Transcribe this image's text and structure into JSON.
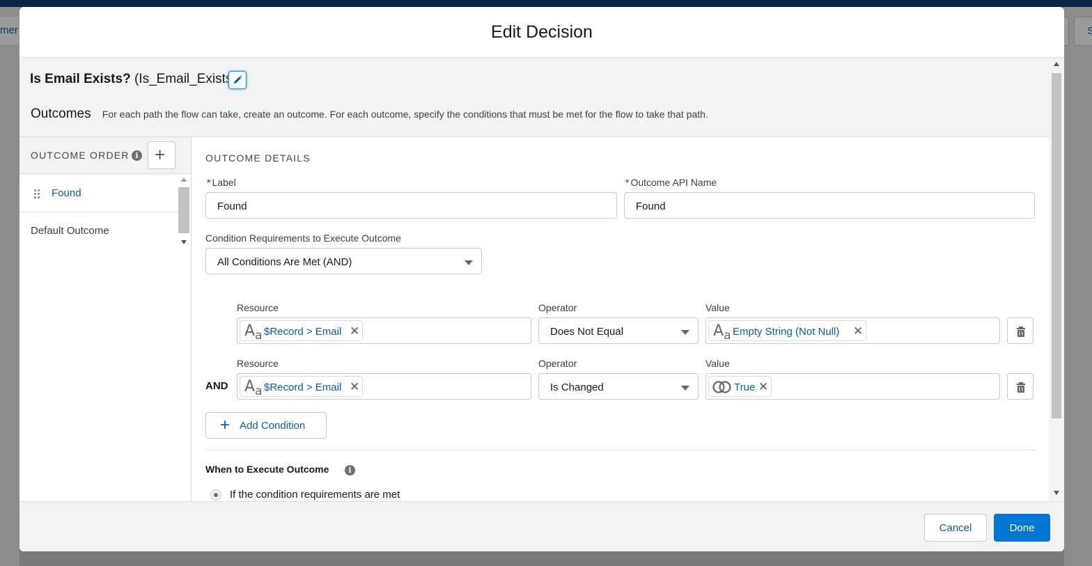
{
  "background": {
    "left_button_text": "mer",
    "right_button_text": "S"
  },
  "modal": {
    "title": "Edit Decision"
  },
  "decision": {
    "label": "Is Email Exists?",
    "api_name": "(Is_Email_Exists)"
  },
  "outcomes": {
    "heading": "Outcomes",
    "description": "For each path the flow can take, create an outcome. For each outcome, specify the conditions that must be met for the flow to take that path."
  },
  "outcome_order": {
    "header": "OUTCOME ORDER",
    "info_icon": "i",
    "add_icon": "+",
    "items": [
      {
        "label": "Found",
        "selected": true
      },
      {
        "label": "Default Outcome",
        "selected": false
      }
    ]
  },
  "details": {
    "section_title": "OUTCOME DETAILS",
    "required_marker": "*",
    "label_field": {
      "label": "Label",
      "value": "Found"
    },
    "api_field": {
      "label": "Outcome API Name",
      "value": "Found"
    },
    "requirements": {
      "label": "Condition Requirements to Execute Outcome",
      "value": "All Conditions Are Met (AND)"
    },
    "conditions": [
      {
        "resource_label": "Resource",
        "resource_value": "$Record > Email",
        "operator_label": "Operator",
        "operator_value": "Does Not Equal",
        "value_label": "Value",
        "value_value": "Empty String (Not Null)",
        "value_icon": "text-icon"
      },
      {
        "logic": "AND",
        "resource_label": "Resource",
        "resource_value": "$Record > Email",
        "operator_label": "Operator",
        "operator_value": "Is Changed",
        "value_label": "Value",
        "value_value": "True",
        "value_icon": "boolean-icon"
      }
    ],
    "add_condition_icon": "+",
    "add_condition": "Add Condition",
    "when_label": "When to Execute Outcome",
    "when_info_icon": "i",
    "when_options": [
      {
        "label": "If the condition requirements are met",
        "selected": true
      }
    ]
  },
  "footer": {
    "cancel": "Cancel",
    "done": "Done"
  },
  "icons": {
    "text_glyph_big": "A",
    "text_glyph_small": "a",
    "remove_glyph": "✕"
  },
  "colors": {
    "brand": "#0176d3",
    "link": "#0b5cab",
    "required": "#ba0517",
    "nav_bar": "#0b2548"
  }
}
